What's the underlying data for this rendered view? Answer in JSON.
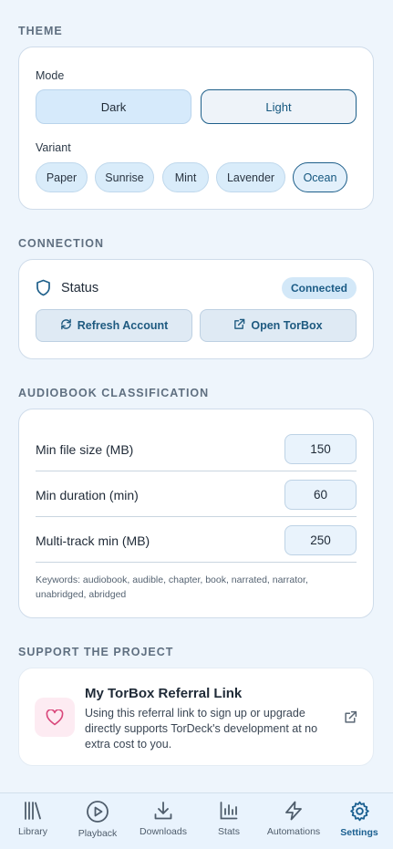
{
  "theme": {
    "section_title": "THEME",
    "mode_label": "Mode",
    "modes": [
      "Dark",
      "Light"
    ],
    "selected_mode": "Light",
    "variant_label": "Variant",
    "variants": [
      "Paper",
      "Sunrise",
      "Mint",
      "Lavender",
      "Ocean"
    ],
    "selected_variant": "Ocean"
  },
  "connection": {
    "section_title": "CONNECTION",
    "status_label": "Status",
    "status_badge": "Connected",
    "refresh_label": "Refresh Account",
    "open_label": "Open TorBox",
    "icons": [
      "shield-icon",
      "refresh-icon",
      "external-link-icon"
    ]
  },
  "audiobook": {
    "section_title": "AUDIOBOOK CLASSIFICATION",
    "fields": [
      {
        "label": "Min file size (MB)",
        "value": "150"
      },
      {
        "label": "Min duration (min)",
        "value": "60"
      },
      {
        "label": "Multi-track min (MB)",
        "value": "250"
      }
    ],
    "keywords": "Keywords: audiobook, audible, chapter, book, narrated, narrator, unabridged, abridged"
  },
  "support": {
    "section_title": "SUPPORT THE PROJECT",
    "title": "My TorBox Referral Link",
    "description": "Using this referral link to sign up or upgrade directly supports TorDeck's development at no extra cost to you.",
    "icons": [
      "heart-icon",
      "external-link-icon"
    ]
  },
  "nav": {
    "items": [
      {
        "label": "Library",
        "icon": "library-icon"
      },
      {
        "label": "Playback",
        "icon": "play-circle-icon"
      },
      {
        "label": "Downloads",
        "icon": "download-icon"
      },
      {
        "label": "Stats",
        "icon": "bar-chart-icon"
      },
      {
        "label": "Automations",
        "icon": "lightning-icon"
      },
      {
        "label": "Settings",
        "icon": "gear-icon"
      }
    ],
    "active": "Settings"
  },
  "colors": {
    "background": "#eef5fc",
    "accent": "#1e5f8a",
    "chip_bg": "#d9ecfa",
    "heart": "#d9467a"
  }
}
